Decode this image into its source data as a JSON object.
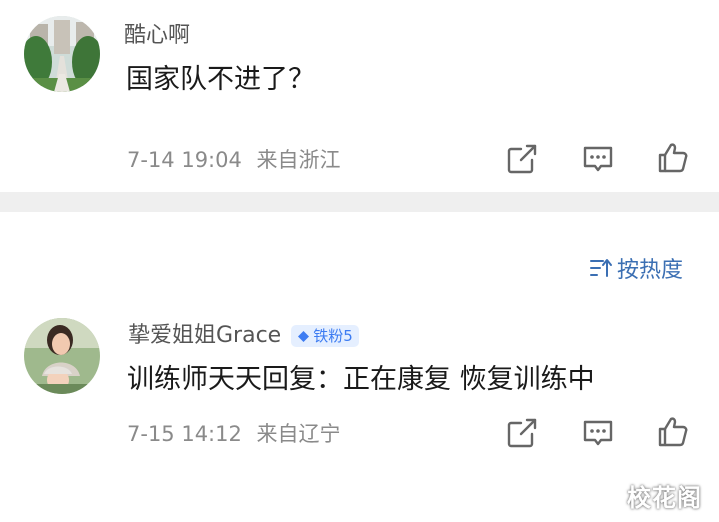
{
  "comments": [
    {
      "username": "酷心啊",
      "text": "国家队不进了？",
      "time": "7-14 19:04",
      "location": "来自浙江"
    },
    {
      "username": "挚爱姐姐Grace",
      "badge": "铁粉5",
      "text": "训练师天天回复：正在康复 恢复训练中",
      "time": "7-15 14:12",
      "location": "来自辽宁"
    }
  ],
  "sort": {
    "label": "按热度"
  },
  "watermark": "校花阁",
  "colors": {
    "link_blue": "#3b6fb3",
    "badge_blue": "#3d7cf2",
    "meta_gray": "#8a8a8a",
    "band_gray": "#efefef"
  },
  "icons": [
    "share-icon",
    "comment-icon",
    "like-icon",
    "sort-icon",
    "diamond-icon"
  ]
}
